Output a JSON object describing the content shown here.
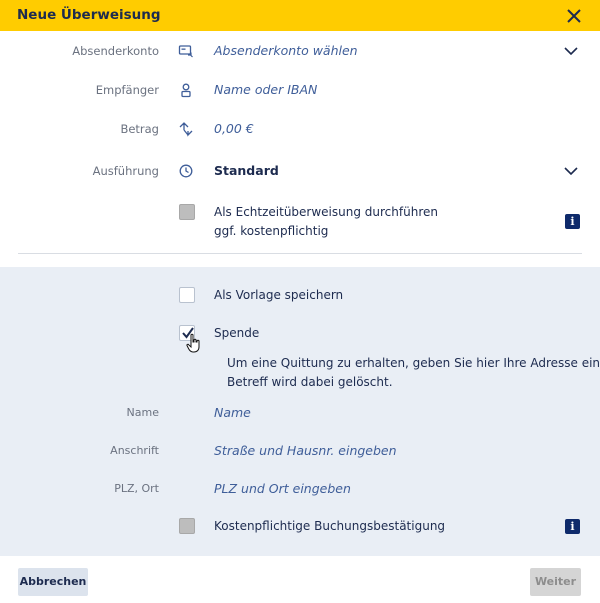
{
  "header": {
    "title": "Neue Überweisung",
    "close_icon": "close-icon"
  },
  "form": {
    "sender": {
      "label": "Absenderkonto",
      "value": "Absenderkonto wählen",
      "icon": "account-card-icon"
    },
    "recipient": {
      "label": "Empfänger",
      "placeholder": "Name oder IBAN",
      "icon": "person-icon"
    },
    "amount": {
      "label": "Betrag",
      "value": "0,00 €",
      "icon": "transfer-arrows-icon"
    },
    "execution": {
      "label": "Ausführung",
      "value": "Standard",
      "icon": "clock-icon"
    },
    "realtime": {
      "line1": "Als Echtzeitüberweisung durchführen",
      "line2": "ggf. kostenpflichtig",
      "checked": false,
      "info": "i"
    }
  },
  "options": {
    "template": {
      "label": "Als Vorlage speichern",
      "checked": false
    },
    "donation": {
      "label": "Spende",
      "checked": true
    },
    "note_line1": "Um eine Quittung zu erhalten, geben Sie hier Ihre Adresse ein, I",
    "note_line2": "Betreff wird dabei gelöscht.",
    "name": {
      "label": "Name",
      "placeholder": "Name"
    },
    "address": {
      "label": "Anschrift",
      "placeholder": "Straße und Hausnr. eingeben"
    },
    "zip_city": {
      "label": "PLZ, Ort",
      "placeholder": "PLZ und Ort eingeben"
    },
    "confirmation": {
      "label": "Kostenpflichtige Buchungsbestätigung",
      "checked": false,
      "info": "i"
    }
  },
  "footer": {
    "cancel_label": "Abbrechen",
    "next_label": "Weiter"
  },
  "colors": {
    "header_bg": "#ffcc00",
    "text_dark": "#1d2b4f",
    "text_link": "#3f5e99",
    "panel_bg": "#e9eef5"
  }
}
